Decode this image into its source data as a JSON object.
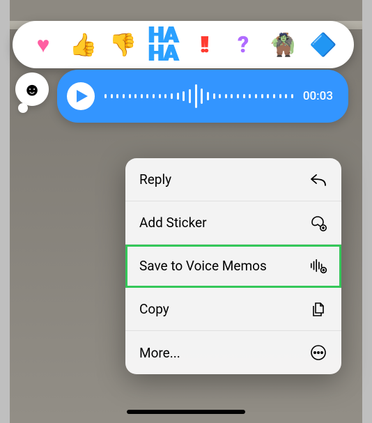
{
  "reactions": [
    {
      "name": "heart",
      "glyph": "♥"
    },
    {
      "name": "thumbs-up",
      "glyph": "👍"
    },
    {
      "name": "thumbs-down",
      "glyph": "👎"
    },
    {
      "name": "haha",
      "glyph": "HA HA"
    },
    {
      "name": "exclaim",
      "glyph": "!!"
    },
    {
      "name": "question",
      "glyph": "?"
    },
    {
      "name": "custom-sticker",
      "glyph": "🧌"
    }
  ],
  "emoji_picker_glyph": "☻",
  "audio_message": {
    "duration_label": "00:03",
    "duration_seconds": 3,
    "state": "paused"
  },
  "context_menu": {
    "items": [
      {
        "id": "reply",
        "label": "Reply",
        "highlight": false
      },
      {
        "id": "add-sticker",
        "label": "Add Sticker",
        "highlight": false
      },
      {
        "id": "save-voice-memos",
        "label": "Save to Voice Memos",
        "highlight": true
      },
      {
        "id": "copy",
        "label": "Copy",
        "highlight": false
      },
      {
        "id": "more",
        "label": "More...",
        "highlight": false
      }
    ]
  },
  "waveform_heights": [
    6,
    6,
    6,
    6,
    6,
    6,
    6,
    6,
    6,
    6,
    6,
    8,
    10,
    14,
    20,
    34,
    22,
    12,
    8,
    6,
    6,
    6,
    6,
    6,
    6,
    6,
    6,
    6,
    6,
    6,
    6,
    6
  ]
}
